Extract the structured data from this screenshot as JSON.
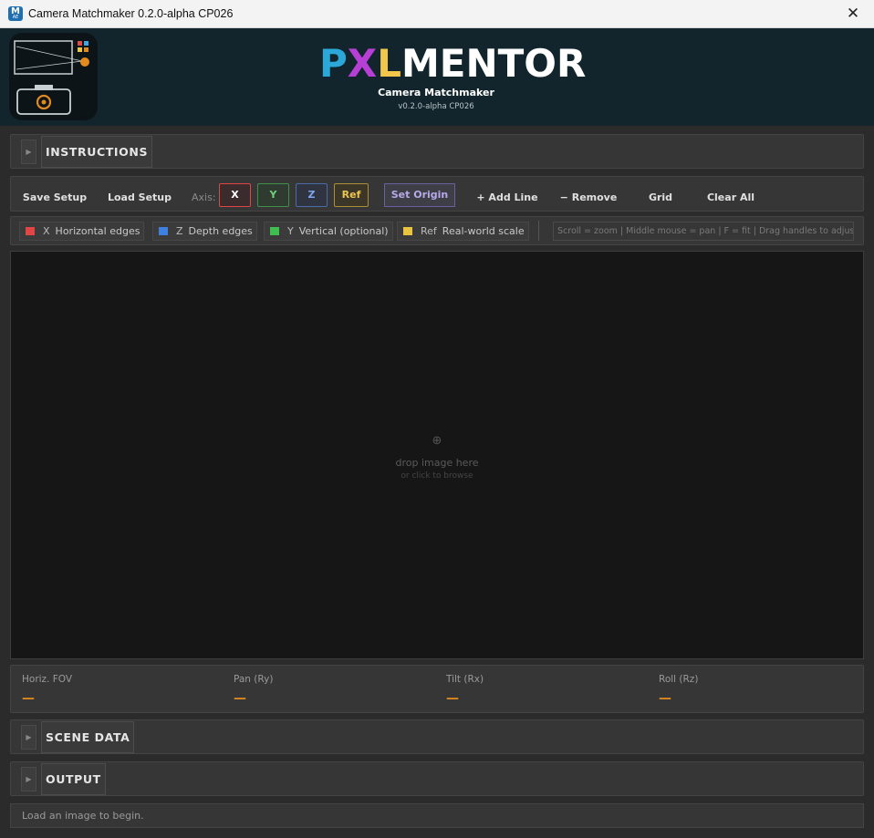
{
  "window": {
    "title": "Camera Matchmaker  0.2.0-alpha CP026",
    "app_icon_letter": "M",
    "close_label": "✕"
  },
  "header": {
    "brand_p": "P",
    "brand_x": "X",
    "brand_l": "L",
    "brand_rest": "MENTOR",
    "app_name": "Camera Matchmaker",
    "version": "v0.2.0-alpha CP026",
    "logo_icon": "camera-logo-icon"
  },
  "sections": {
    "instructions": "INSTRUCTIONS",
    "scene_data": "SCENE DATA",
    "output": "OUTPUT",
    "expand_arrow": "▶"
  },
  "toolbar": {
    "save_setup": "Save Setup",
    "load_setup": "Load Setup",
    "axis_label": "Axis:",
    "axis_x": "X",
    "axis_y": "Y",
    "axis_z": "Z",
    "axis_ref": "Ref",
    "set_origin": "Set Origin",
    "add_line": "+ Add Line",
    "remove": "− Remove",
    "grid": "Grid",
    "clear_all": "Clear All"
  },
  "legend": {
    "x_axis": "X",
    "x_desc": "Horizontal edges",
    "z_axis": "Z",
    "z_desc": "Depth edges",
    "y_axis": "Y",
    "y_desc": "Vertical (optional)",
    "ref_axis": "Ref",
    "ref_desc": "Real-world scale",
    "hint": "Scroll = zoom  |  Middle mouse = pan  |  F = fit  |  Drag handles to adjust"
  },
  "colors": {
    "x": "#e04646",
    "y": "#3fbf4f",
    "z": "#3f7fe0",
    "ref": "#e8c440",
    "accent": "#e28a1e"
  },
  "viewport": {
    "drop_icon": "⊕",
    "drop_text": "drop image here",
    "drop_sub": "or click to browse"
  },
  "readouts": {
    "fov_label": "Horiz. FOV",
    "fov_value": "—",
    "pan_label": "Pan (Ry)",
    "pan_value": "—",
    "tilt_label": "Tilt (Rx)",
    "tilt_value": "—",
    "roll_label": "Roll (Rz)",
    "roll_value": "—"
  },
  "status": {
    "message": "Load an image to begin."
  }
}
